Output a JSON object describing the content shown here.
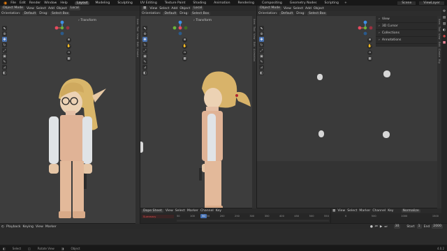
{
  "menu": {
    "items": [
      "File",
      "Edit",
      "Render",
      "Window",
      "Help"
    ],
    "workspace_tabs": [
      "Layout",
      "Modeling",
      "Sculpting",
      "UV Editing",
      "Texture Paint",
      "Shading",
      "Animation",
      "Rendering",
      "Compositing",
      "Geometry Nodes",
      "Scripting"
    ],
    "active_tab": "Layout",
    "scene": "Scene",
    "view_layer": "ViewLayer"
  },
  "viewport_header": {
    "mode": "Object Mode",
    "view": "View",
    "select": "Select",
    "add": "Add",
    "object": "Object",
    "transform_space": "Local",
    "orientation_label": "Orientation:",
    "orientation_value": "Default",
    "drag_label": "Drag:",
    "drag_value": "Select Box"
  },
  "n_panel": {
    "transform": "Transform",
    "view": "View",
    "cursor": "3D Cursor",
    "collections": "Collections",
    "annotations": "Annotations"
  },
  "side_tabs": [
    "Item",
    "Tool",
    "View",
    "Edit",
    "Create",
    "Animation",
    "Rig"
  ],
  "dopesheet": {
    "editor": "Dope Sheet",
    "view": "View",
    "select": "Select",
    "marker": "Marker",
    "channel": "Channel",
    "key": "Key",
    "summary": "Summary",
    "frames": [
      "50",
      "100",
      "150",
      "200",
      "250",
      "300",
      "350",
      "400",
      "450",
      "500",
      "550"
    ],
    "current_frame": "30"
  },
  "graph": {
    "view": "View",
    "select": "Select",
    "marker": "Marker",
    "channel": "Channel",
    "key": "Key",
    "normalize": "Normalize",
    "frames": [
      "0",
      "500",
      "1000",
      "1500"
    ]
  },
  "timeline": {
    "playback": "Playback",
    "keying": "Keying",
    "view": "View",
    "marker": "Marker",
    "current_frame": "30",
    "start_label": "Start",
    "start": "1",
    "end_label": "End",
    "end": "2000"
  },
  "status": {
    "select": "Select",
    "rotate": "Rotate View",
    "menu": "Object",
    "version": "4.0.2"
  }
}
